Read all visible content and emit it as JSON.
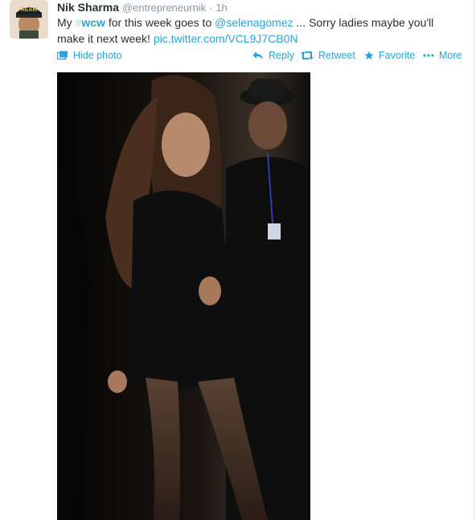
{
  "tweet": {
    "fullname": "Nik Sharma",
    "username": "@entrepreneurnik",
    "separator": "·",
    "time": "1h",
    "text": {
      "prefix": "My ",
      "hashtag_symbol": "#",
      "hashtag": "wcw",
      "middle": " for this week goes to ",
      "mention": "@selenagomez",
      "suffix": " ... Sorry ladies maybe you'll make it next week! ",
      "link": "pic.twitter.com/VCL9J7CB0N"
    },
    "avatar_cap_text": "REAM"
  },
  "actions": {
    "hide_photo": "Hide photo",
    "reply": "Reply",
    "retweet": "Retweet",
    "favorite": "Favorite",
    "more": "More"
  },
  "colors": {
    "link": "#2aa3d6",
    "name": "#292f33",
    "meta": "#8899a6"
  }
}
